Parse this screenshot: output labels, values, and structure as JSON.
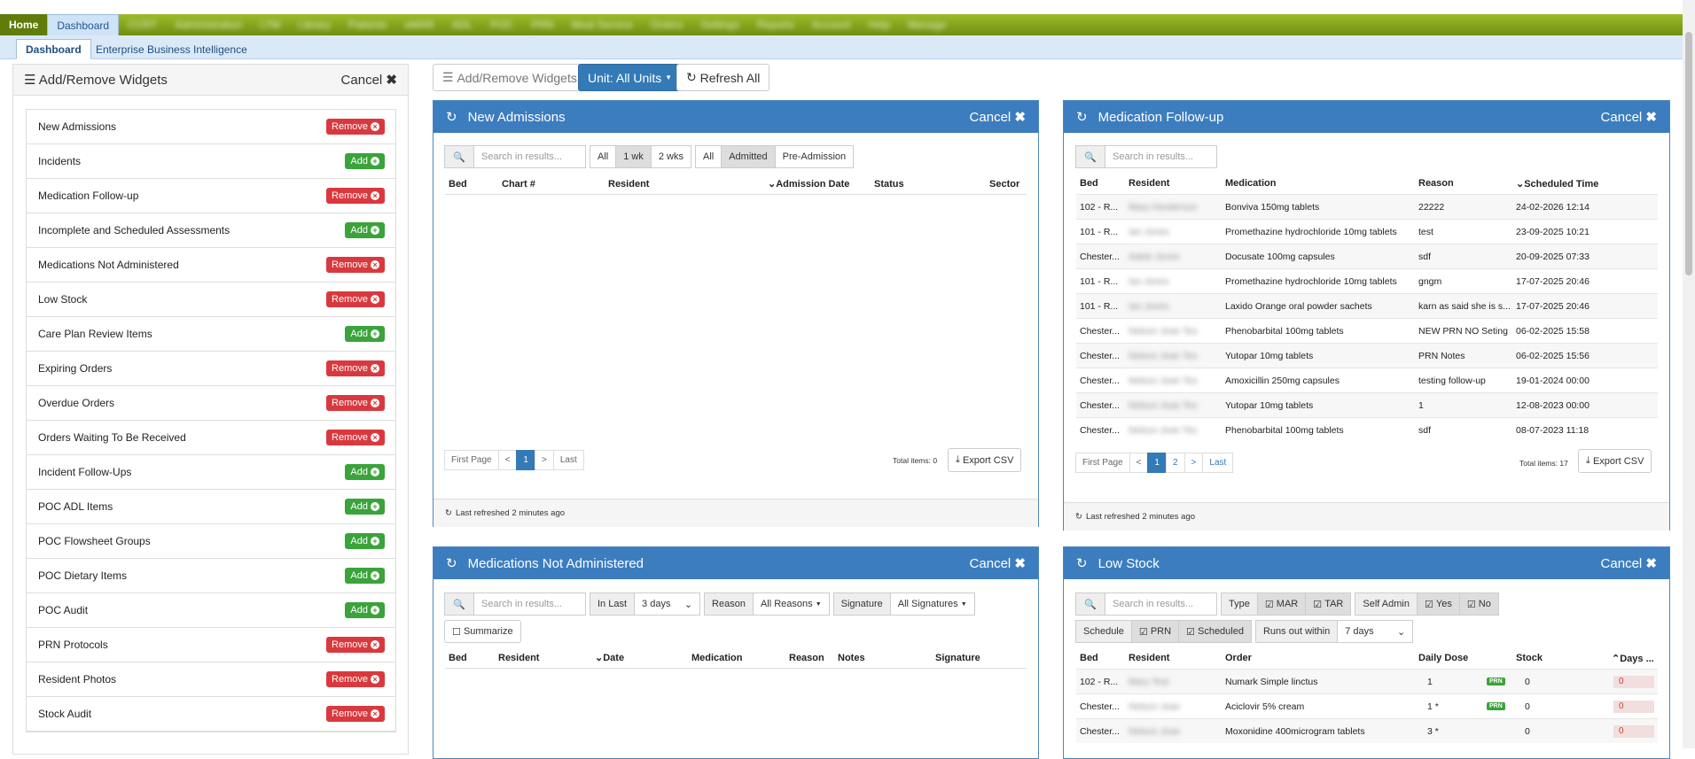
{
  "topnav": {
    "home": "Home",
    "dashboard": "Dashboard",
    "blurred": [
      "CCRT",
      "Administration",
      "LTM",
      "Library",
      "Patients",
      "eMAR",
      "ADL",
      "POC",
      "PRN",
      "Meal Service",
      "Orders",
      "Settings",
      "Reports",
      "Account",
      "Help",
      "Manage"
    ]
  },
  "subnav": {
    "dashboard": "Dashboard",
    "ebi": "Enterprise Business Intelligence"
  },
  "sidebar": {
    "title": "Add/Remove Widgets",
    "cancel": "Cancel",
    "remove_label": "Remove",
    "add_label": "Add",
    "items": [
      {
        "label": "New Admissions",
        "action": "remove"
      },
      {
        "label": "Incidents",
        "action": "add"
      },
      {
        "label": "Medication Follow-up",
        "action": "remove"
      },
      {
        "label": "Incomplete and Scheduled Assessments",
        "action": "add"
      },
      {
        "label": "Medications Not Administered",
        "action": "remove"
      },
      {
        "label": "Low Stock",
        "action": "remove"
      },
      {
        "label": "Care Plan Review Items",
        "action": "add"
      },
      {
        "label": "Expiring Orders",
        "action": "remove"
      },
      {
        "label": "Overdue Orders",
        "action": "remove"
      },
      {
        "label": "Orders Waiting To Be Received",
        "action": "remove"
      },
      {
        "label": "Incident Follow-Ups",
        "action": "add"
      },
      {
        "label": "POC ADL Items",
        "action": "add"
      },
      {
        "label": "POC Flowsheet Groups",
        "action": "add"
      },
      {
        "label": "POC Dietary Items",
        "action": "add"
      },
      {
        "label": "POC Audit",
        "action": "add"
      },
      {
        "label": "PRN Protocols",
        "action": "remove"
      },
      {
        "label": "Resident Photos",
        "action": "remove"
      },
      {
        "label": "Stock Audit",
        "action": "remove"
      }
    ]
  },
  "toolbar": {
    "add_remove": "Add/Remove Widgets",
    "unit": "Unit: All Units",
    "refresh": "Refresh All"
  },
  "common": {
    "cancel": "Cancel",
    "search_placeholder": "Search in results...",
    "first_page": "First Page",
    "prev": "<",
    "next": ">",
    "last": "Last",
    "export": "Export CSV"
  },
  "new_admissions": {
    "title": "New Admissions",
    "filters": [
      "All",
      "1 wk",
      "2 wks",
      "All",
      "Admitted",
      "Pre-Admission"
    ],
    "columns": [
      "Bed",
      "Chart #",
      "Resident",
      "Admission Date",
      "Status",
      "Sector"
    ],
    "page": "1",
    "total": "Total items: 0",
    "refreshed": "Last refreshed 2 minutes ago"
  },
  "med_followup": {
    "title": "Medication Follow-up",
    "columns": [
      "Bed",
      "Resident",
      "Medication",
      "Reason",
      "Scheduled Time"
    ],
    "rows": [
      {
        "bed": "102 - R...",
        "resident": "Mary Henderson",
        "medication": "Bonviva 150mg tablets",
        "reason": "22222",
        "time": "24-02-2026 12:14"
      },
      {
        "bed": "101 - R...",
        "resident": "Ian Jones",
        "medication": "Promethazine hydrochloride 10mg tablets",
        "reason": "test",
        "time": "23-09-2025 10:21"
      },
      {
        "bed": "Chester...",
        "resident": "Adele Jones",
        "medication": "Docusate 100mg capsules",
        "reason": "sdf",
        "time": "20-09-2025 07:33"
      },
      {
        "bed": "101 - R...",
        "resident": "Ian Jones",
        "medication": "Promethazine hydrochloride 10mg tablets",
        "reason": "gngm",
        "time": "17-07-2025 20:46"
      },
      {
        "bed": "101 - R...",
        "resident": "Ian Jones",
        "medication": "Laxido Orange oral powder sachets",
        "reason": "karn as said she is s...",
        "time": "17-07-2025 20:46"
      },
      {
        "bed": "Chester...",
        "resident": "Nelson Jean Tes",
        "medication": "Phenobarbital 100mg tablets",
        "reason": "NEW PRN NO Seting",
        "time": "06-02-2025 15:58"
      },
      {
        "bed": "Chester...",
        "resident": "Nelson Jean Tes",
        "medication": "Yutopar 10mg tablets",
        "reason": "PRN Notes",
        "time": "06-02-2025 15:56"
      },
      {
        "bed": "Chester...",
        "resident": "Nelson Jean Tes",
        "medication": "Amoxicillin 250mg capsules",
        "reason": "testing follow-up",
        "time": "19-01-2024 00:00"
      },
      {
        "bed": "Chester...",
        "resident": "Nelson Jean Tes",
        "medication": "Yutopar 10mg tablets",
        "reason": "1",
        "time": "12-08-2023 00:00"
      },
      {
        "bed": "Chester...",
        "resident": "Nelson Jean Tes",
        "medication": "Phenobarbital 100mg tablets",
        "reason": "sdf",
        "time": "08-07-2023 11:18"
      }
    ],
    "pages": [
      "1",
      "2"
    ],
    "total": "Total items: 17",
    "refreshed": "Last refreshed 2 minutes ago"
  },
  "meds_not_admin": {
    "title": "Medications Not Administered",
    "in_last": "In Last",
    "in_last_value": "3 days",
    "reason": "Reason",
    "reason_value": "All Reasons",
    "signature": "Signature",
    "signature_value": "All Signatures",
    "summarize": "Summarize",
    "columns": [
      "Bed",
      "Resident",
      "Date",
      "Medication",
      "Reason",
      "Notes",
      "Signature"
    ]
  },
  "low_stock": {
    "title": "Low Stock",
    "type": "Type",
    "mar": "MAR",
    "tar": "TAR",
    "self_admin": "Self Admin",
    "yes": "Yes",
    "no": "No",
    "schedule": "Schedule",
    "prn": "PRN",
    "scheduled": "Scheduled",
    "runs_out": "Runs out within",
    "runs_out_value": "7 days",
    "columns": [
      "Bed",
      "Resident",
      "Order",
      "Daily Dose",
      "Stock",
      "Days ..."
    ],
    "prn_badge": "PRN",
    "rows": [
      {
        "bed": "102 - R...",
        "resident": "Mary Test",
        "order": "Numark Simple linctus",
        "dose": "1",
        "stock": "0",
        "days": "0"
      },
      {
        "bed": "Chester...",
        "resident": "Nelson Jean",
        "order": "Aciclovir 5% cream",
        "dose": "1 *",
        "stock": "0",
        "days": "0"
      },
      {
        "bed": "Chester...",
        "resident": "Nelson Jean",
        "order": "Moxonidine 400microgram tablets",
        "dose": "3 *",
        "stock": "0",
        "days": "0"
      }
    ]
  }
}
